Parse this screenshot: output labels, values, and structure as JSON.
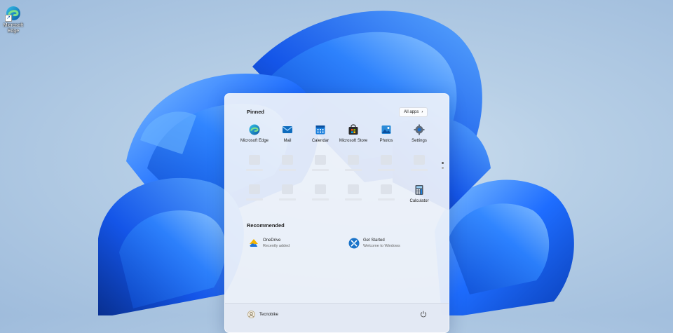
{
  "desktop": {
    "icons": [
      {
        "label": "Microsoft Edge",
        "icon": "edge-icon"
      }
    ]
  },
  "start_menu": {
    "pinned_title": "Pinned",
    "all_apps_label": "All apps",
    "pinned_apps": [
      {
        "label": "Microsoft Edge",
        "icon": "edge-icon"
      },
      {
        "label": "Mail",
        "icon": "mail-icon"
      },
      {
        "label": "Calendar",
        "icon": "calendar-icon"
      },
      {
        "label": "Microsoft Store",
        "icon": "store-icon"
      },
      {
        "label": "Photos",
        "icon": "photos-icon"
      },
      {
        "label": "Settings",
        "icon": "settings-icon"
      }
    ],
    "last_app": {
      "label": "Calculator",
      "icon": "calculator-icon"
    },
    "recommended_title": "Recommended",
    "recommended": [
      {
        "name": "OneDrive",
        "sub": "Recently added",
        "icon": "onedrive-icon"
      },
      {
        "name": "Get Started",
        "sub": "Welcome to Windows",
        "icon": "get-started-icon"
      }
    ],
    "user": {
      "name": "Tecnobike"
    }
  },
  "colors": {
    "wallpaper_blue": "#1a6fff",
    "accent": "#0078d4"
  }
}
